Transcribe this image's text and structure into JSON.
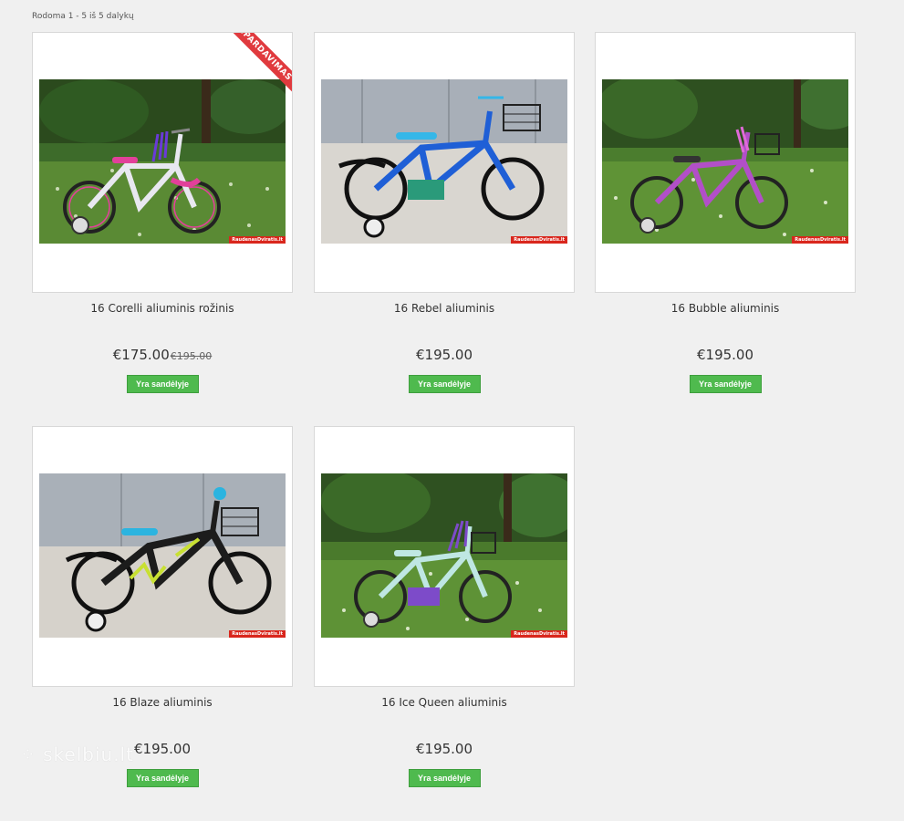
{
  "showing_text": "Rodoma 1 - 5 iš 5 dalykų",
  "sale_ribbon": "IŠPARDAVIMAS",
  "stock_badge": "Yra sandėlyje",
  "watermark_overlay": "skelbiu.lt",
  "photo_watermark": "RaudenasDviratis.lt",
  "products": [
    {
      "title": "16 Corelli aliuminis rožinis",
      "price": "€175.00",
      "old_price": "€195.00",
      "bike_color": "#e8e8f0",
      "accent": "#e2409a",
      "scene": "grass"
    },
    {
      "title": "16 Rebel aliuminis",
      "price": "€195.00",
      "old_price": "",
      "bike_color": "#1f5fd6",
      "accent": "#35b7e8",
      "scene": "wall"
    },
    {
      "title": "16 Bubble aliuminis",
      "price": "€195.00",
      "old_price": "",
      "bike_color": "#b24fc8",
      "accent": "#e06ad8",
      "scene": "grass"
    },
    {
      "title": "16 Blaze aliuminis",
      "price": "€195.00",
      "old_price": "",
      "bike_color": "#1c1c1c",
      "accent": "#2bb4e0",
      "scene": "wall"
    },
    {
      "title": "16 Ice Queen aliuminis",
      "price": "€195.00",
      "old_price": "",
      "bike_color": "#bfe7e3",
      "accent": "#7d4bc9",
      "scene": "grass"
    }
  ]
}
